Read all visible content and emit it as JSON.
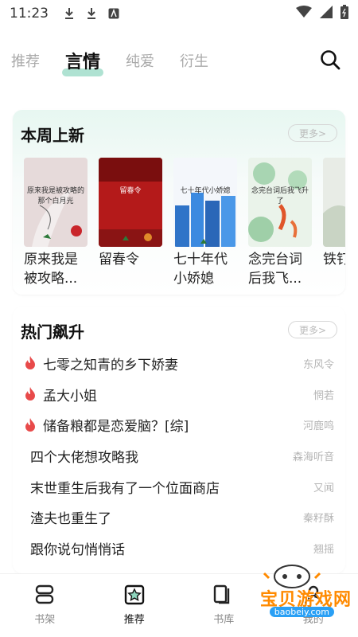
{
  "status_bar": {
    "time": "11:23"
  },
  "top_tabs": [
    {
      "label": "推荐",
      "active": false
    },
    {
      "label": "言情",
      "active": true
    },
    {
      "label": "纯爱",
      "active": false
    },
    {
      "label": "衍生",
      "active": false
    }
  ],
  "new_this_week": {
    "title": "本周上新",
    "more_label": "更多>",
    "books": [
      {
        "title": "原来我是被攻略...",
        "cover_text": "原来我是被攻略的那个白月光",
        "cover_color": "#e6dada"
      },
      {
        "title": "留春令",
        "cover_text": "留春令",
        "cover_color": "#b41a1a"
      },
      {
        "title": "七十年代小娇媳",
        "cover_text": "七十年代小娇媳",
        "cover_color": "#3b7ed1"
      },
      {
        "title": "念完台词后我飞...",
        "cover_text": "念完台词后我飞升了",
        "cover_color": "#dfeee0"
      },
      {
        "title": "铁钉劫",
        "cover_text": "铁",
        "cover_color": "#e8ece6"
      }
    ]
  },
  "hot_rising": {
    "title": "热门飙升",
    "more_label": "更多>",
    "items": [
      {
        "title": "七零之知青的乡下娇妻",
        "author": "东风令",
        "hot": true
      },
      {
        "title": "孟大小姐",
        "author": "惘若",
        "hot": true
      },
      {
        "title": "储备粮都是恋爱脑？[综]",
        "author": "河鹿鸣",
        "hot": true
      },
      {
        "title": "四个大佬想攻略我",
        "author": "森海听音",
        "hot": false
      },
      {
        "title": "末世重生后我有了一个位面商店",
        "author": "又闻",
        "hot": false
      },
      {
        "title": "渣夫也重生了",
        "author": "秦籽酥",
        "hot": false
      },
      {
        "title": "跟你说句悄悄话",
        "author": "翘摇",
        "hot": false
      }
    ]
  },
  "bottom_nav": [
    {
      "label": "书架",
      "icon": "bookshelf-icon",
      "active": false
    },
    {
      "label": "推荐",
      "icon": "recommend-icon",
      "active": true
    },
    {
      "label": "书库",
      "icon": "library-icon",
      "active": false
    },
    {
      "label": "我的",
      "icon": "profile-icon",
      "active": false
    }
  ],
  "watermark": {
    "text": "宝贝游戏网",
    "url": "baobeiy.com"
  },
  "colors": {
    "accent_mint": "#9bdbc7",
    "flame": "#e84a4a",
    "muted_text": "#b5b5b5"
  }
}
